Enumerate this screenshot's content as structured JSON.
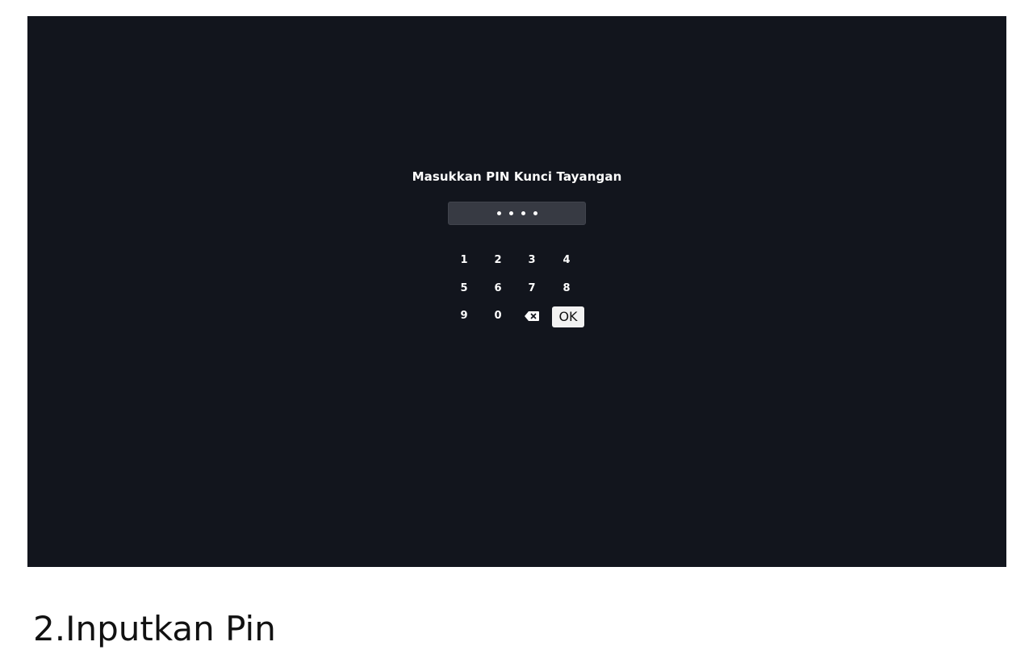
{
  "screen": {
    "title": "Masukkan PIN Kunci Tayangan",
    "pin": {
      "masked_digits": 4,
      "dot_glyph": "•"
    },
    "keypad": {
      "rows": [
        [
          "1",
          "2",
          "3",
          "4"
        ],
        [
          "5",
          "6",
          "7",
          "8"
        ],
        [
          "9",
          "0",
          "backspace-icon",
          "OK"
        ]
      ],
      "ok_label": "OK",
      "backspace_icon": "backspace-icon"
    },
    "colors": {
      "background": "#12151d",
      "pin_field": "#373a43",
      "text": "#ffffff",
      "ok_button_bg": "#f2f2f2"
    }
  },
  "caption": "2.Inputkan Pin"
}
